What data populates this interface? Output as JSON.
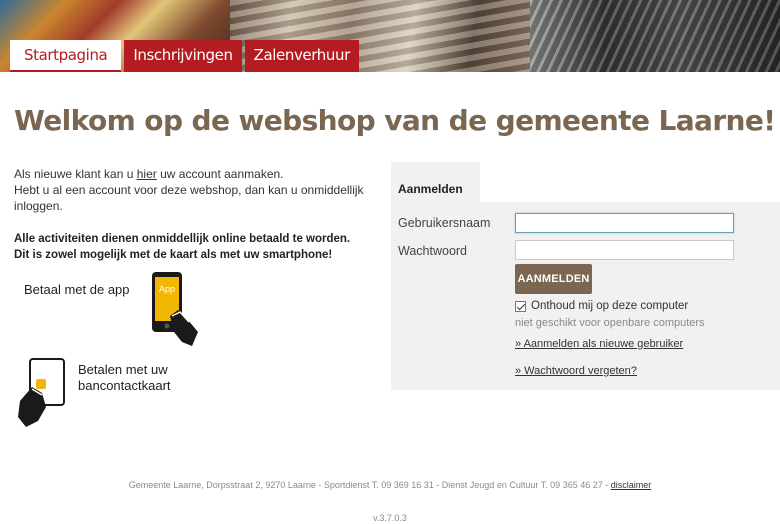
{
  "tabs": {
    "home": "Startpagina",
    "registrations": "Inschrijvingen",
    "room_rental": "Zalenverhuur"
  },
  "title": "Welkom op de webshop van de gemeente Laarne!",
  "intro": {
    "line1_before": "Als nieuwe klant kan u ",
    "line1_link": "hier",
    "line1_after": " uw account aanmaken.",
    "line2": "Hebt u al een account voor deze webshop, dan kan u onmiddellijk inloggen."
  },
  "payment_notice": {
    "line1": "Alle activiteiten dienen onmiddellijk online betaald te worden.",
    "line2": "Dit is zowel mogelijk met de kaart als met uw smartphone!"
  },
  "pay_app_label": "Betaal met de app",
  "pay_app_icon_text": "App",
  "pay_card_label_1": "Betalen met uw",
  "pay_card_label_2": "bancontactkaart",
  "login": {
    "tab_label": "Aanmelden",
    "username_label": "Gebruikersnaam",
    "password_label": "Wachtwoord",
    "username_value": "",
    "password_value": "",
    "button_label": "AANMELDEN",
    "remember_label": "Onthoud mij op deze computer",
    "remember_checked": true,
    "remember_note": "niet geschikt voor openbare computers",
    "register_link": "» Aanmelden als nieuwe gebruiker",
    "forgot_link": "» Wachtwoord vergeten?"
  },
  "footer": {
    "text": "Gemeente Laarne, Dorpsstraat 2, 9270 Laarne - Sportdienst T. 09 369 16 31 - Dienst Jeugd en Cultuur T. 09 365 46 27 - ",
    "disclaimer": "disclaimer",
    "version": "v.3.7.0.3"
  },
  "colors": {
    "brand_red": "#b31c21",
    "brand_brown": "#7a6651",
    "panel_bg": "#f2f1ef",
    "app_yellow": "#f2b705"
  }
}
